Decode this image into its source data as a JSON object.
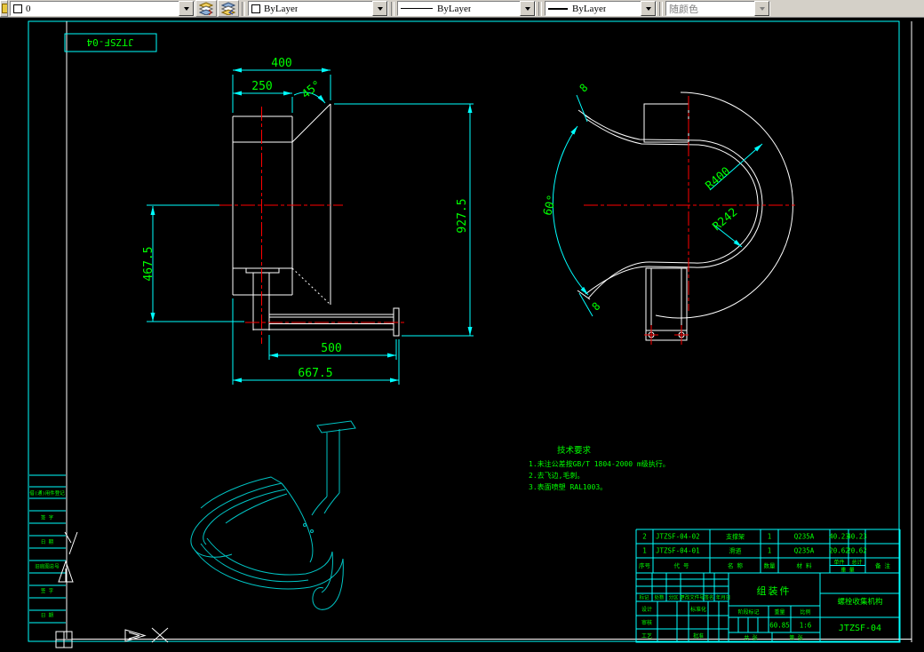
{
  "toolbar": {
    "layer": "0",
    "color": "ByLayer",
    "linetype": "ByLayer",
    "lineweight": "ByLayer",
    "plot_style": "随颜色"
  },
  "sheet": {
    "header_label": "JTZSF-04"
  },
  "dims": {
    "width_top": "400",
    "width_inner": "250",
    "chamfer_angle": "45°",
    "height_total": "927.5",
    "height_left": "467.5",
    "base_inner": "500",
    "base_total": "667.5",
    "radius_outer": "R400",
    "radius_inner": "R242",
    "arc_angle": "60°",
    "thickness_top": "8",
    "thickness_bottom": "8"
  },
  "notes": {
    "title": "技术要求",
    "lines": [
      "1.未注公差按GB/T 1804-2000 m级执行。",
      "2.去飞边,毛刺。",
      "3.表面喷塑 RAL1003。"
    ]
  },
  "bom": {
    "headers": {
      "seq": "序号",
      "code": "代  号",
      "name": "名  称",
      "qty": "数量",
      "material": "材  料",
      "unit": "单件",
      "total": "总计",
      "weight": "重 量",
      "remark": "备  注"
    },
    "rows": [
      {
        "seq": "2",
        "code": "JTZSF-04-02",
        "name": "支撑架",
        "qty": "1",
        "material": "Q235A",
        "unit_weight": "40.23",
        "total_weight": "40.23"
      },
      {
        "seq": "1",
        "code": "JTZSF-04-01",
        "name": "滑道",
        "qty": "1",
        "material": "Q235A",
        "unit_weight": "20.62",
        "total_weight": "20.62"
      }
    ]
  },
  "title_block": {
    "part_name": "组装件",
    "project_name": "螺栓收集机构",
    "drawing_number": "JTZSF-04",
    "stage_label": "阶段标记",
    "weight_label": "重量",
    "scale_label": "比例",
    "weight_value": "60.85",
    "scale_value": "1:6",
    "sheet_total": "共  张",
    "sheet_page": "第  张",
    "design_label": "设计",
    "standard_label": "标准化",
    "check_label": "审核",
    "process_label": "工艺",
    "approve_label": "批准",
    "rev_labels": [
      "标记",
      "处数",
      "分区",
      "更改文件号",
      "签名",
      "年月日"
    ]
  },
  "margin": {
    "labels": [
      "借(通)用件登记",
      "签 字",
      "日 期",
      "旧底图总号",
      "签 字",
      "日 期"
    ]
  }
}
